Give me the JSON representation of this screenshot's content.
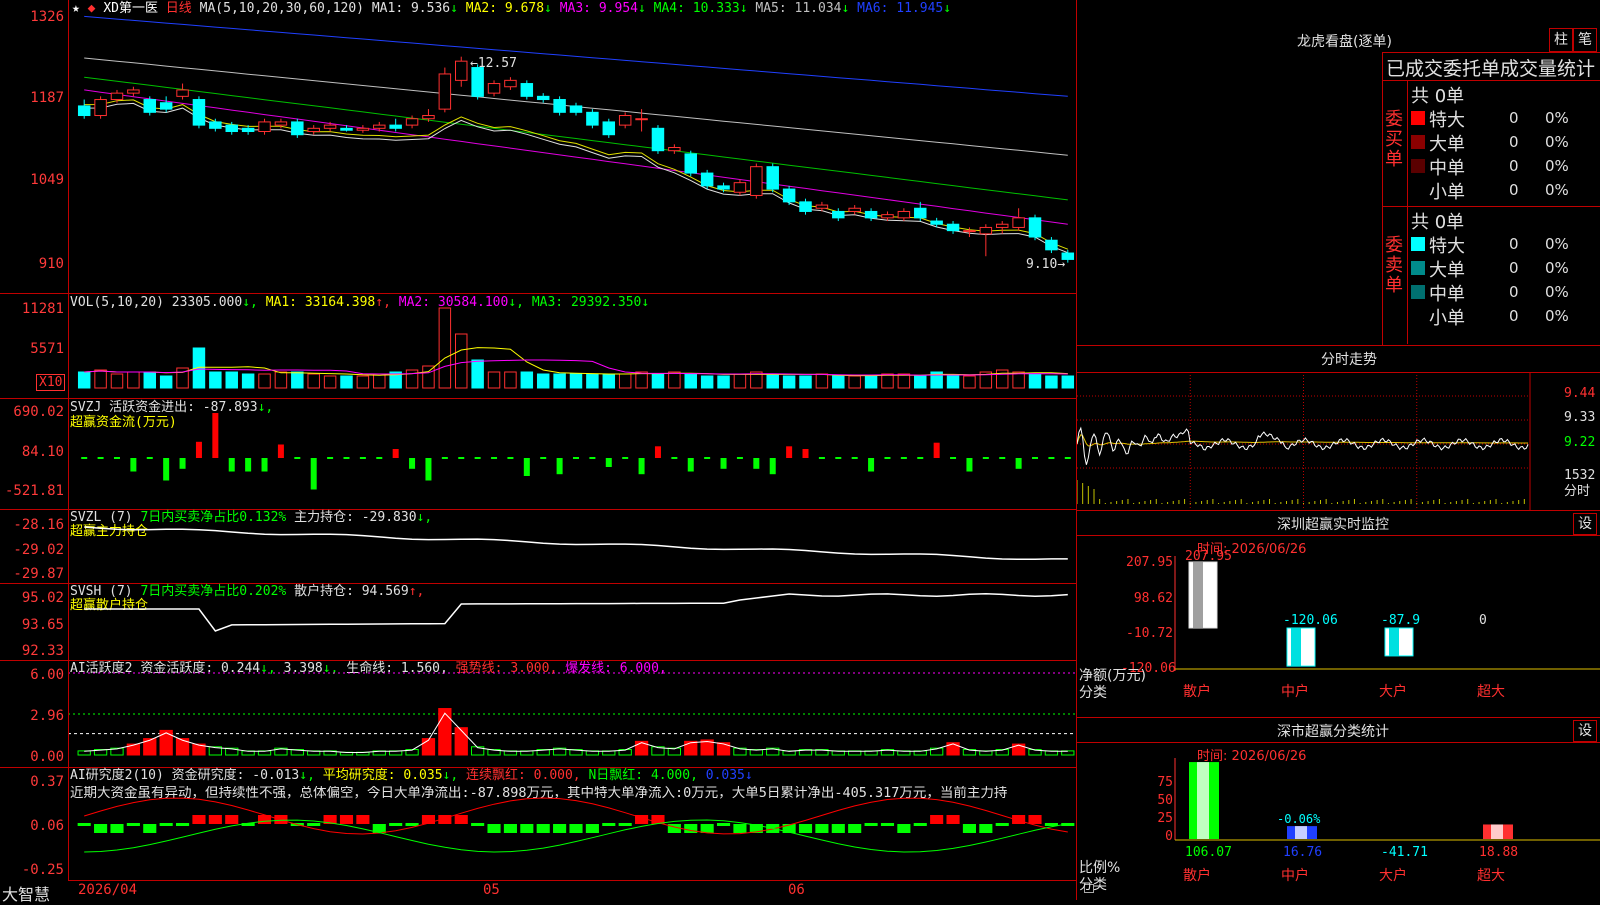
{
  "chart": {
    "header": "XD第一医",
    "mode": "日线",
    "ma_params": "MA(5,10,20,30,60,120)",
    "ma": [
      {
        "label": "MA1: 9.536",
        "dir": "↓",
        "color": "#e0e0e0"
      },
      {
        "label": "MA2: 9.678",
        "dir": "↓",
        "color": "#ffff00"
      },
      {
        "label": "MA3: 9.954",
        "dir": "↓",
        "color": "#ff00ff"
      },
      {
        "label": "MA4: 10.333",
        "dir": "↓",
        "color": "#00ff00"
      },
      {
        "label": "MA5: 11.034",
        "dir": "↓",
        "color": "#c0c0c0"
      },
      {
        "label": "MA6: 11.945",
        "dir": "↓",
        "color": "#2040ff"
      }
    ],
    "y_ticks": [
      "1326",
      "1187",
      "1049",
      "910"
    ],
    "high_label": "12.57",
    "last_label": "9.10",
    "candles": [
      [
        11.8,
        11.65,
        11.9,
        11.6
      ],
      [
        11.65,
        11.9,
        11.95,
        11.6
      ],
      [
        11.9,
        12.0,
        12.05,
        11.85
      ],
      [
        12.0,
        12.05,
        12.1,
        11.95
      ],
      [
        11.9,
        11.7,
        11.95,
        11.65
      ],
      [
        11.85,
        11.75,
        11.95,
        11.7
      ],
      [
        11.95,
        12.05,
        12.15,
        11.9
      ],
      [
        11.9,
        11.5,
        11.95,
        11.45
      ],
      [
        11.55,
        11.45,
        11.6,
        11.4
      ],
      [
        11.5,
        11.4,
        11.55,
        11.35
      ],
      [
        11.45,
        11.4,
        11.5,
        11.35
      ],
      [
        11.4,
        11.55,
        11.6,
        11.35
      ],
      [
        11.5,
        11.55,
        11.6,
        11.45
      ],
      [
        11.55,
        11.35,
        11.6,
        11.3
      ],
      [
        11.4,
        11.45,
        11.5,
        11.35
      ],
      [
        11.45,
        11.5,
        11.55,
        11.4
      ],
      [
        11.45,
        11.42,
        11.5,
        11.4
      ],
      [
        11.42,
        11.45,
        11.5,
        11.38
      ],
      [
        11.45,
        11.5,
        11.55,
        11.4
      ],
      [
        11.5,
        11.45,
        11.6,
        11.4
      ],
      [
        11.5,
        11.6,
        11.65,
        11.45
      ],
      [
        11.6,
        11.65,
        11.75,
        11.55
      ],
      [
        11.75,
        12.3,
        12.4,
        11.7
      ],
      [
        12.2,
        12.5,
        12.57,
        12.1
      ],
      [
        12.4,
        11.95,
        12.45,
        11.9
      ],
      [
        12.0,
        12.15,
        12.2,
        11.95
      ],
      [
        12.1,
        12.2,
        12.25,
        12.05
      ],
      [
        12.15,
        11.95,
        12.2,
        11.9
      ],
      [
        11.95,
        11.9,
        12.0,
        11.85
      ],
      [
        11.9,
        11.7,
        11.95,
        11.65
      ],
      [
        11.8,
        11.7,
        11.85,
        11.65
      ],
      [
        11.7,
        11.5,
        11.75,
        11.45
      ],
      [
        11.55,
        11.35,
        11.6,
        11.3
      ],
      [
        11.5,
        11.65,
        11.7,
        11.45
      ],
      [
        11.6,
        11.6,
        11.75,
        11.4
      ],
      [
        11.45,
        11.1,
        11.5,
        11.05
      ],
      [
        11.1,
        11.15,
        11.2,
        11.05
      ],
      [
        11.05,
        10.75,
        11.1,
        10.7
      ],
      [
        10.75,
        10.55,
        10.8,
        10.5
      ],
      [
        10.55,
        10.5,
        10.6,
        10.45
      ],
      [
        10.45,
        10.6,
        10.65,
        10.4
      ],
      [
        10.4,
        10.85,
        10.9,
        10.35
      ],
      [
        10.85,
        10.5,
        10.9,
        10.45
      ],
      [
        10.5,
        10.3,
        10.55,
        10.25
      ],
      [
        10.3,
        10.15,
        10.35,
        10.1
      ],
      [
        10.2,
        10.25,
        10.3,
        10.15
      ],
      [
        10.15,
        10.05,
        10.2,
        10.0
      ],
      [
        10.15,
        10.2,
        10.25,
        10.1
      ],
      [
        10.15,
        10.05,
        10.2,
        10.0
      ],
      [
        10.05,
        10.1,
        10.15,
        10.0
      ],
      [
        10.05,
        10.15,
        10.2,
        10.0
      ],
      [
        10.2,
        10.05,
        10.3,
        10.0
      ],
      [
        10.0,
        9.95,
        10.05,
        9.9
      ],
      [
        9.95,
        9.85,
        10.0,
        9.8
      ],
      [
        9.85,
        9.85,
        9.9,
        9.75
      ],
      [
        9.8,
        9.9,
        9.95,
        9.45
      ],
      [
        9.9,
        9.95,
        10.0,
        9.8
      ],
      [
        9.9,
        10.05,
        10.2,
        9.85
      ],
      [
        10.05,
        9.75,
        10.1,
        9.7
      ],
      [
        9.7,
        9.55,
        9.75,
        9.5
      ],
      [
        9.5,
        9.4,
        9.55,
        9.35
      ]
    ],
    "ma_lines": {
      "ma1_start": 11.8,
      "ma1_end": 9.55,
      "ma2_start": 11.9,
      "ma2_end": 9.65,
      "ma3_start": 12.05,
      "ma3_end": 9.95,
      "ma4_start": 12.25,
      "ma4_end": 10.33,
      "ma5_start": 12.55,
      "ma5_end": 11.03,
      "ma6_start": 13.2,
      "ma6_end": 11.95
    }
  },
  "vol": {
    "header": "VOL(5,10,20)",
    "value": "23305.000",
    "ma1": "MA1: 33164.398",
    "ma2": "MA2: 30584.100",
    "ma3": "MA3: 29392.350",
    "y_ticks": [
      "11281",
      "5571"
    ],
    "unit": "X10",
    "bars": [
      8,
      9,
      7,
      8,
      8,
      6,
      10,
      20,
      8,
      8,
      7,
      7,
      8,
      8,
      7,
      6,
      6,
      6,
      7,
      8,
      9,
      11,
      40,
      27,
      14,
      8,
      8,
      8,
      7,
      7,
      7,
      7,
      7,
      7,
      8,
      7,
      8,
      7,
      6,
      6,
      7,
      8,
      7,
      6,
      6,
      7,
      6,
      6,
      6,
      7,
      7,
      6,
      8,
      6,
      6,
      8,
      9,
      8,
      7,
      6,
      6
    ]
  },
  "svzj": {
    "header": "SVZJ",
    "title": "活跃资金进出: -87.893",
    "dir": "↓,",
    "subtitle": "超赢资金流(万元)",
    "y_ticks": [
      "690.02",
      "84.10",
      "-521.81"
    ],
    "bars": [
      0,
      0,
      0,
      -1.5,
      0,
      -2.5,
      -1.2,
      1.8,
      5,
      -1.5,
      -1.5,
      -1.5,
      1.5,
      0,
      -3.5,
      0,
      0,
      0,
      0,
      1,
      -1.2,
      -2.5,
      0,
      0,
      0,
      0,
      0,
      -2,
      0,
      -1.8,
      0,
      0,
      -1,
      0,
      -1.8,
      1.3,
      0,
      -1.5,
      0,
      -1.2,
      0,
      -1.2,
      -1.8,
      1.3,
      1,
      0,
      0,
      0,
      -1.5,
      0,
      0,
      0,
      1.7,
      0,
      -1.5,
      0,
      0,
      -1.2,
      0,
      0,
      0
    ]
  },
  "svzl": {
    "header": "SVZL (7)",
    "ratio": "7日内买卖净占比0.132%",
    "hold": "主力持仓: -29.830",
    "dir": "↓,",
    "subtitle": "超赢主力持仓",
    "y_ticks": [
      "-28.16",
      "-29.02",
      "-29.87"
    ]
  },
  "svsh": {
    "header": "SVSH (7)",
    "ratio": "7日内买卖净占比0.202%",
    "hold": "散户持仓: 94.569",
    "dir": "↑,",
    "subtitle": "超赢散户持仓",
    "y_ticks": [
      "95.02",
      "93.65",
      "92.33"
    ]
  },
  "ai1": {
    "header": "AI活跃度2",
    "act": "资金活跃度: 0.244",
    "v2": "3.398",
    "life": "生命线: 1.560,",
    "strong": "强势线: 3.000,",
    "burst": "爆发线: 6.000,",
    "y_ticks": [
      "6.00",
      "2.96",
      "0.00"
    ],
    "bars": [
      0.3,
      0.4,
      0.5,
      0.8,
      1.2,
      1.8,
      1.2,
      0.8,
      0.6,
      0.5,
      0.3,
      0.3,
      0.5,
      0.4,
      0.3,
      0.3,
      0.2,
      0.2,
      0.3,
      0.3,
      0.4,
      1.2,
      3.4,
      2.0,
      0.6,
      0.4,
      0.3,
      0.3,
      0.4,
      0.5,
      0.4,
      0.3,
      0.3,
      0.4,
      1.0,
      0.6,
      0.5,
      1.0,
      1.1,
      0.9,
      0.5,
      0.4,
      0.5,
      0.3,
      0.4,
      0.4,
      0.3,
      0.3,
      0.3,
      0.4,
      0.3,
      0.3,
      0.5,
      0.9,
      0.4,
      0.3,
      0.4,
      0.8,
      0.4,
      0.3,
      0.3
    ]
  },
  "ai2": {
    "header": "AI研究度2(10)",
    "study": "资金研究度: -0.013",
    "avg": "平均研究度: 0.035",
    "cont": "连续飘红: 0.000,",
    "nday": "N日飘红: 4.000,",
    "last": "0.035",
    "comment": "近期大资金虽有异动，但持续性不强，总体偏空，今日大单净流出:-87.898万元，其中特大单净流入:0万元，大单5日累计净出-405.317万元，当前主力持",
    "y_ticks": [
      "0.37",
      "0.06",
      "-0.25"
    ],
    "bars": [
      0,
      -1,
      -1,
      0,
      -1,
      0,
      0,
      1,
      1,
      1,
      0,
      1,
      1,
      0,
      0,
      1,
      1,
      1,
      -1,
      0,
      0,
      1,
      1,
      1,
      0,
      -1,
      -1,
      -1,
      -1,
      -1,
      -1,
      -1,
      0,
      0,
      1,
      1,
      -1,
      -1,
      -1,
      0,
      -1,
      -1,
      -1,
      -1,
      -1,
      -1,
      -1,
      -1,
      0,
      0,
      -1,
      0,
      1,
      1,
      -1,
      -1,
      0,
      1,
      1,
      0,
      0
    ]
  },
  "xaxis": {
    "labels": [
      "2026/04",
      "05",
      "06"
    ]
  },
  "brand": "大智慧",
  "right": {
    "lhkp": {
      "title": "龙虎看盘(逐单)",
      "btn1": "柱",
      "btn2": "笔",
      "stats_title": "已成交委托单成交量统计",
      "buy_label": "委买单",
      "sell_label": "委卖单",
      "buy_total": "共 0单",
      "sell_total": "共 0单",
      "buy_rows": [
        {
          "name": "特大",
          "count": "0",
          "pct": "0%",
          "color": "#ff0000"
        },
        {
          "name": "大单",
          "count": "0",
          "pct": "0%",
          "color": "#8b0000"
        },
        {
          "name": "中单",
          "count": "0",
          "pct": "0%",
          "color": "#5a0000"
        },
        {
          "name": "小单",
          "count": "0",
          "pct": "0%",
          "color": ""
        }
      ],
      "sell_rows": [
        {
          "name": "特大",
          "count": "0",
          "pct": "0%",
          "color": "#00ffff"
        },
        {
          "name": "大单",
          "count": "0",
          "pct": "0%",
          "color": "#008b8b"
        },
        {
          "name": "中单",
          "count": "0",
          "pct": "0%",
          "color": "#007070"
        },
        {
          "name": "小单",
          "count": "0",
          "pct": "0%",
          "color": ""
        }
      ]
    },
    "fs": {
      "title": "分时走势",
      "y_ticks": [
        "9.44",
        "9.33",
        "9.22"
      ],
      "vol_tick": "1532",
      "vol_label": "分时"
    },
    "monitor": {
      "title": "深圳超赢实时监控",
      "set": "设",
      "time": "时间: 2026/06/26",
      "y_ticks": [
        "207.95",
        "98.62",
        "-10.72",
        "-120.06"
      ],
      "unit": "净额(万元)",
      "cat_label": "分类",
      "cats": [
        "散户",
        "中户",
        "大户",
        "超大"
      ],
      "values": [
        207.95,
        -120.06,
        -87.9,
        0
      ],
      "value_labels": [
        "207.95",
        "-120.06",
        "-87.9",
        "0"
      ]
    },
    "classify": {
      "title": "深市超赢分类统计",
      "set": "设",
      "time": "时间: 2026/06/26",
      "y_ticks": [
        "75",
        "50",
        "25",
        "0"
      ],
      "unit": "比例%",
      "cat_label": "分类",
      "cats": [
        "散户",
        "中户",
        "大户",
        "超大"
      ],
      "value_labels": [
        "106.07",
        "16.76",
        "-41.71",
        "18.88"
      ],
      "annot": "-0.06%",
      "bar_values": [
        106.07,
        16.76,
        0,
        18.88
      ]
    }
  }
}
